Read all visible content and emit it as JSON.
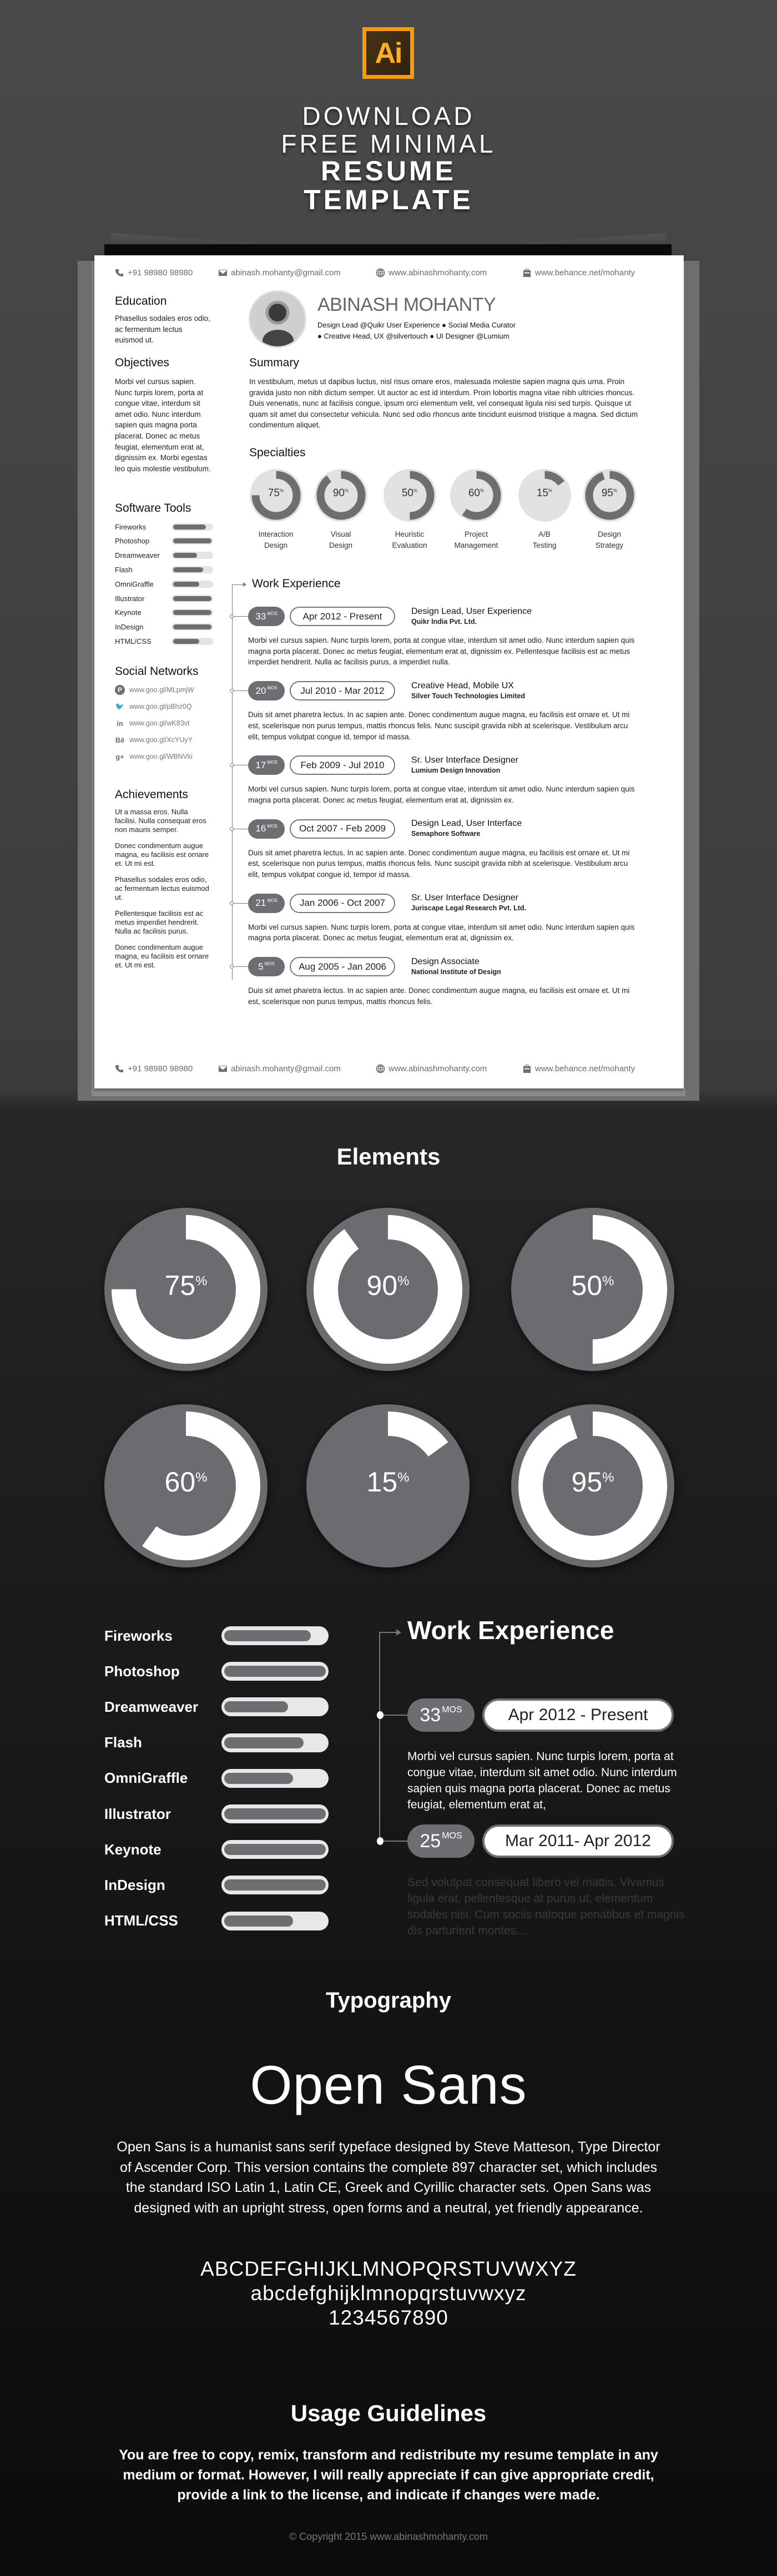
{
  "header": {
    "logo_text": "Ai",
    "logo_color": "#ff9a00",
    "line1": "DOWNLOAD",
    "line2": "FREE MINIMAL",
    "line3": "RESUME",
    "line4": "TEMPLATE"
  },
  "resume": {
    "contacts": [
      {
        "icon": "phone-icon",
        "text": "+91 98980 98980"
      },
      {
        "icon": "email-icon",
        "text": "abinash.mohanty@gmail.com"
      },
      {
        "icon": "globe-icon",
        "text": "www.abinashmohanty.com"
      },
      {
        "icon": "briefcase-icon",
        "text": "www.behance.net/mohanty"
      }
    ],
    "name": "ABINASH MOHANTY",
    "tagline_1": "Design Lead @Quikr User Experience ● Social Media Curator",
    "tagline_2": "● Creative Head, UX @silvertouch ● UI Designer @Lumium",
    "education": {
      "heading": "Education",
      "text": "Phasellus sodales eros odio, ac fermentum lectus euismod ut."
    },
    "objectives": {
      "heading": "Objectives",
      "text": "Morbi vel cursus sapien. Nunc turpis lorem, porta at congue vitae, interdum sit amet odio. Nunc interdum sapien quis magna porta placerat. Donec ac metus feugiat, elementum erat at, dignissim ex. Morbi egestas leo quis molestie vestibulum."
    },
    "summary": {
      "heading": "Summary",
      "text": "In vestibulum, metus ut dapibus luctus, nisl risus ornare eros, malesuada molestie sapien magna quis urna. Proin gravida justo non nibh dictum semper. Ut auctor ac est id interdum. Proin lobortis magna vitae nibh ultricies rhoncus. Duis venenatis, nunc at facilisis congue, ipsum orci elementum velit, vel consequat ligula nisi sed turpis. Quisque ut quam sit amet dui consectetur vehicula. Nunc sed odio rhoncus ante tincidunt euismod tristique a magna. Sed dictum condimentum aliquet."
    },
    "software": {
      "heading": "Software Tools",
      "items": [
        {
          "name": "Fireworks",
          "level": 0.85
        },
        {
          "name": "Photoshop",
          "level": 1.0
        },
        {
          "name": "Dreamweaver",
          "level": 0.63
        },
        {
          "name": "Flash",
          "level": 0.78
        },
        {
          "name": "OmniGraffle",
          "level": 0.68
        },
        {
          "name": "Illustrator",
          "level": 1.0
        },
        {
          "name": "Keynote",
          "level": 1.0
        },
        {
          "name": "InDesign",
          "level": 1.0
        },
        {
          "name": "HTML/CSS",
          "level": 0.68
        }
      ]
    },
    "social": {
      "heading": "Social Networks",
      "items": [
        {
          "icon": "pinterest-icon",
          "glyph": "P",
          "url": "www.goo.gl/MLpmjW"
        },
        {
          "icon": "twitter-icon",
          "glyph": "🐦",
          "url": "www.goo.gl/pBhz0Q"
        },
        {
          "icon": "linkedin-icon",
          "glyph": "in",
          "url": "www.goo.gl/wK83vt"
        },
        {
          "icon": "behance-icon",
          "glyph": "Bē",
          "url": "www.goo.gl/XcYUyY"
        },
        {
          "icon": "googleplus-icon",
          "glyph": "g+",
          "url": "www.goo.gl/WBNVki"
        }
      ]
    },
    "achievements": {
      "heading": "Achievements",
      "items": [
        "Ut a massa eros. Nulla facilisi. Nulla consequat eros non mauris semper.",
        "Donec condimentum augue magna, eu facilisis est ornare et. Ut mi est.",
        "Phasellus sodales eros odio, ac fermentum lectus euismod ut.",
        "Pellentesque facilisis est ac metus imperdiet hendrerit. Nulla ac facilisis purus.",
        "Donec condimentum augue magna, eu facilisis est ornare et. Ut mi est."
      ]
    },
    "specialties": {
      "heading": "Specialties",
      "unit": "%",
      "items": [
        {
          "value": 75,
          "label_1": "Interaction",
          "label_2": "Design"
        },
        {
          "value": 90,
          "label_1": "Visual",
          "label_2": "Design"
        },
        {
          "value": 50,
          "label_1": "Heuristic",
          "label_2": "Evaluation"
        },
        {
          "value": 60,
          "label_1": "Project",
          "label_2": "Management"
        },
        {
          "value": 15,
          "label_1": "A/B",
          "label_2": "Testing"
        },
        {
          "value": 95,
          "label_1": "Design",
          "label_2": "Strategy"
        }
      ]
    },
    "work": {
      "heading": "Work Experience",
      "unit": "MOS",
      "entries": [
        {
          "months": "33",
          "dates": "Apr 2012 - Present",
          "title": "Design Lead, User Experience",
          "company": "Quikr India Pvt. Ltd.",
          "body": "Morbi vel cursus sapien. Nunc turpis lorem, porta at congue vitae, interdum sit amet odio. Nunc interdum sapien quis magna porta placerat. Donec ac metus feugiat, elementum erat at, dignissim ex. Pellentesque facilisis est ac metus imperdiet hendrerit. Nulla ac facilisis purus, a imperdiet nulla."
        },
        {
          "months": "20",
          "dates": "Jul 2010 - Mar 2012",
          "title": "Creative Head, Mobile UX",
          "company": "Silver Touch Technologies Limited",
          "body": "Duis sit amet pharetra lectus. In ac sapien ante. Donec condimentum augue magna, eu facilisis est ornare et. Ut mi est, scelerisque non purus tempus, mattis rhoncus felis. Nunc suscipit gravida nibh at scelerisque. Vestibulum arcu elit, tempus volutpat congue id, tempor id massa."
        },
        {
          "months": "17",
          "dates": "Feb 2009 - Jul 2010",
          "title": "Sr. User Interface Designer",
          "company": "Lumium Design Innovation",
          "body": "Morbi vel cursus sapien. Nunc turpis lorem, porta at congue vitae, interdum sit amet odio. Nunc interdum sapien quis magna porta placerat. Donec ac metus feugiat, elementum erat at, dignissim ex."
        },
        {
          "months": "16",
          "dates": "Oct 2007 - Feb 2009",
          "title": "Design Lead, User Interface",
          "company": "Semaphore Software",
          "body": "Duis sit amet pharetra lectus. In ac sapien ante. Donec condimentum augue magna, eu facilisis est ornare et. Ut mi est, scelerisque non purus tempus, mattis rhoncus felis. Nunc suscipit gravida nibh at scelerisque. Vestibulum arcu elit, tempus volutpat congue id, tempor id massa."
        },
        {
          "months": "21",
          "dates": "Jan 2006 - Oct 2007",
          "title": "Sr. User Interface Designer",
          "company": "Juriscape Legal Research Pvt. Ltd.",
          "body": "Morbi vel cursus sapien. Nunc turpis lorem, porta at congue vitae, interdum sit amet odio. Nunc interdum sapien quis magna porta placerat. Donec ac metus feugiat, elementum erat at, dignissim ex."
        },
        {
          "months": "5",
          "dates": "Aug 2005 - Jan 2006",
          "title": "Design Associate",
          "company": "National Institute of Design",
          "body": "Duis sit amet pharetra lectus. In ac sapien ante. Donec condimentum augue magna, eu facilisis est ornare et. Ut mi est, scelerisque non purus tempus, mattis rhoncus felis."
        }
      ]
    }
  },
  "elements": {
    "heading": "Elements",
    "donuts": [
      75,
      90,
      50,
      60,
      15,
      95
    ],
    "unit": "%",
    "work_heading": "Work Experience",
    "unit_mos": "MOS",
    "work_entries": [
      {
        "months": "33",
        "dates": "Apr 2012 - Present",
        "body": "Morbi vel cursus sapien. Nunc turpis lorem, porta at congue vitae, interdum sit amet odio. Nunc interdum sapien quis magna porta placerat. Donec ac metus feugiat, elementum erat at,"
      },
      {
        "months": "25",
        "dates": "Mar 2011- Apr 2012",
        "body": "Sed volutpat consequat libero vel mattis. Vivamus ligula erat, pellentesque at purus ut, elementum sodales nisi. Cum sociis natoque penatibus et magnis dis parturient montes...."
      }
    ]
  },
  "typography": {
    "heading": "Typography",
    "font_name": "Open Sans",
    "description": "Open Sans is a humanist sans serif typeface designed by Steve Matteson, Type Director of Ascender Corp. This version contains the complete 897 character set, which includes the standard ISO Latin 1, Latin CE, Greek and Cyrillic character sets. Open Sans was designed with an upright stress, open forms and a neutral, yet friendly appearance.",
    "uppercase": "ABCDEFGHIJKLMNOPQRSTUVWXYZ",
    "lowercase": "abcdefghijklmnopqrstuvwxyz",
    "digits": "1234567890"
  },
  "usage": {
    "heading": "Usage Guidelines",
    "text": "You are free to copy, remix, transform and redistribute my resume template in any medium or format. However, I will really appreciate if can give appropriate credit, provide a link to the license, and indicate if changes were made.",
    "copyright": "© Copyright 2015  www.abinashmohanty.com"
  },
  "colors": {
    "accent_gray": "#6d6d72",
    "ring_light": "#e2e2e2",
    "logo_orange": "#ff9a00"
  }
}
